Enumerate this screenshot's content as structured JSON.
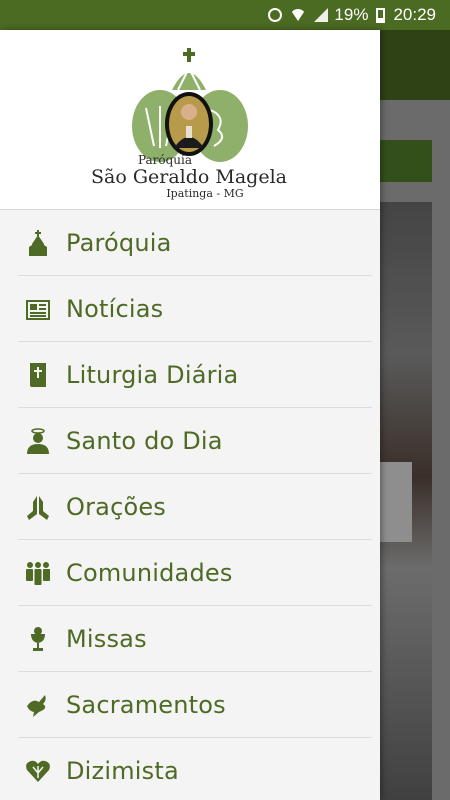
{
  "status_bar": {
    "battery_percent": "19%",
    "time": "20:29",
    "icons": [
      "alarm-icon",
      "wifi-icon",
      "signal-icon",
      "battery-icon"
    ]
  },
  "drawer": {
    "header": {
      "logo_line1": "Paróquia",
      "logo_line2": "São Geraldo Magela",
      "logo_line3": "Ipatinga - MG"
    },
    "items": [
      {
        "label": "Paróquia",
        "icon": "church-icon"
      },
      {
        "label": "Notícias",
        "icon": "newspaper-icon"
      },
      {
        "label": "Liturgia Diária",
        "icon": "bible-icon"
      },
      {
        "label": "Santo do Dia",
        "icon": "saint-icon"
      },
      {
        "label": "Orações",
        "icon": "praying-hands-icon"
      },
      {
        "label": "Comunidades",
        "icon": "community-icon"
      },
      {
        "label": "Missas",
        "icon": "chalice-icon"
      },
      {
        "label": "Sacramentos",
        "icon": "dove-icon"
      },
      {
        "label": "Dizimista",
        "icon": "heart-icon"
      }
    ]
  },
  "colors": {
    "status_bar": "#4b6a22",
    "accent": "#4e6a24",
    "logo_green": "#8fb06a"
  }
}
